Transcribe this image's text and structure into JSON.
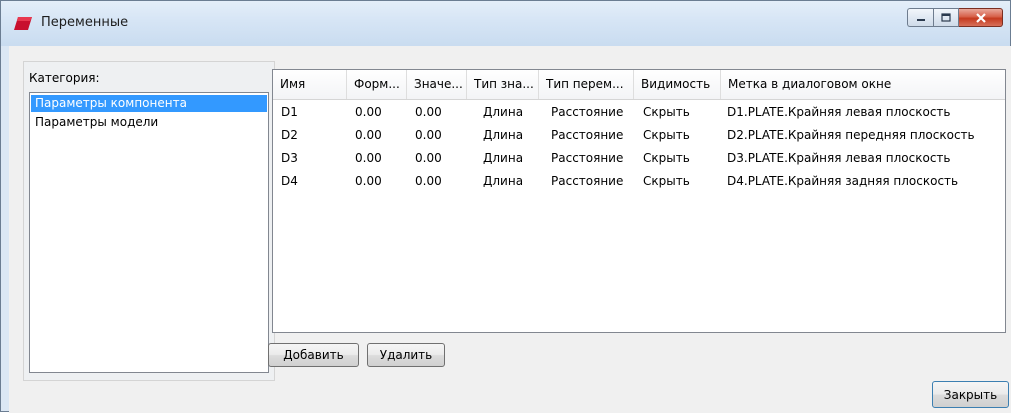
{
  "window": {
    "title": "Переменные"
  },
  "categories": {
    "label": "Категория:",
    "items": [
      {
        "label": "Параметры компонента",
        "selected": true
      },
      {
        "label": "Параметры модели",
        "selected": false
      }
    ]
  },
  "table": {
    "columns": [
      "Имя",
      "Форм...",
      "Значе...",
      "Тип зна...",
      "Тип перем...",
      "Видимость",
      "Метка в диалоговом окне"
    ],
    "rows": [
      [
        "D1",
        "0.00",
        "0.00",
        "Длина",
        "Расстояние",
        "Скрыть",
        "D1.PLATE.Крайняя левая плоскость"
      ],
      [
        "D2",
        "0.00",
        "0.00",
        "Длина",
        "Расстояние",
        "Скрыть",
        "D2.PLATE.Крайняя передняя плоскость"
      ],
      [
        "D3",
        "0.00",
        "0.00",
        "Длина",
        "Расстояние",
        "Скрыть",
        "D3.PLATE.Крайняя левая плоскость"
      ],
      [
        "D4",
        "0.00",
        "0.00",
        "Длина",
        "Расстояние",
        "Скрыть",
        "D4.PLATE.Крайняя задняя плоскость"
      ]
    ]
  },
  "buttons": {
    "add": "Добавить",
    "delete": "Удалить",
    "close": "Закрыть"
  }
}
